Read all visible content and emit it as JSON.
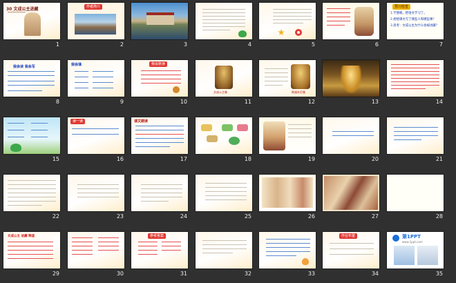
{
  "app": {
    "title": "Slide sorter"
  },
  "slides": [
    {
      "num": "1",
      "title": "30 文成公主进藏"
    },
    {
      "num": "2",
      "banner": "作者简介"
    },
    {
      "num": "3"
    },
    {
      "num": "4"
    },
    {
      "num": "5"
    },
    {
      "num": "6"
    },
    {
      "num": "7",
      "banner": "预习检查",
      "lines": [
        "1.学唐朝，把语文学习了。",
        "2.想想课文写了哪些人和哪些事？",
        "3.思考：文成公主为什么会被进藏？"
      ]
    },
    {
      "num": "8",
      "title": "我会读 我会写"
    },
    {
      "num": "9",
      "banner": "我会填"
    },
    {
      "num": "10",
      "banner": "我会默读"
    },
    {
      "num": "11",
      "caption": "文成公主像"
    },
    {
      "num": "12",
      "caption": "释迦牟尼像"
    },
    {
      "num": "13"
    },
    {
      "num": "14"
    },
    {
      "num": "15"
    },
    {
      "num": "16",
      "banner": "读一读"
    },
    {
      "num": "17",
      "title": "课文朗读"
    },
    {
      "num": "18"
    },
    {
      "num": "19"
    },
    {
      "num": "20"
    },
    {
      "num": "21"
    },
    {
      "num": "22"
    },
    {
      "num": "23"
    },
    {
      "num": "24"
    },
    {
      "num": "25"
    },
    {
      "num": "26"
    },
    {
      "num": "27"
    },
    {
      "num": "28"
    },
    {
      "num": "29",
      "title": "文成公主 进藏 释迦"
    },
    {
      "num": "30"
    },
    {
      "num": "31",
      "banner": "参考答案"
    },
    {
      "num": "32"
    },
    {
      "num": "33"
    },
    {
      "num": "34",
      "banner": "作业布置"
    },
    {
      "num": "35",
      "brand": "第1PPT",
      "url": "www.1ppt.com"
    }
  ],
  "colors": {
    "background": "#303030",
    "number": "#ededed",
    "accent": "#e03a34"
  }
}
